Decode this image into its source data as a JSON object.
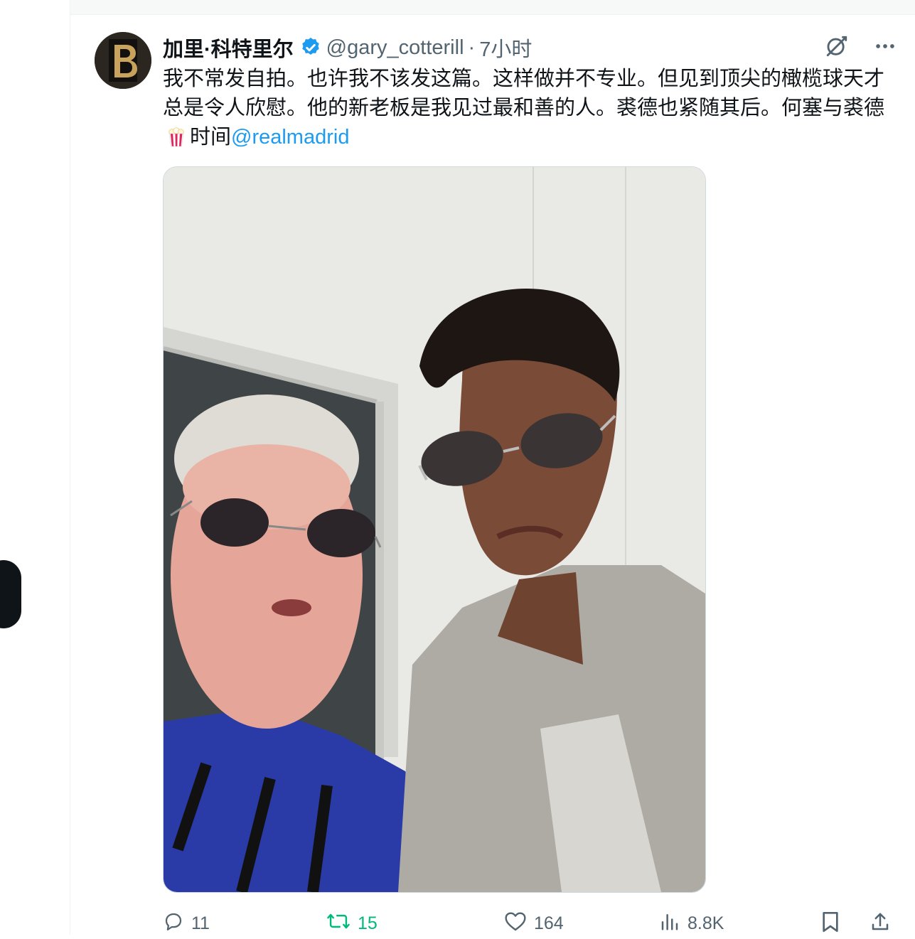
{
  "tweet": {
    "author": {
      "display_name": "加里·科特里尔",
      "handle": "@gary_cotterill",
      "avatar_letter": "B",
      "verified": true
    },
    "separator": "·",
    "timestamp": "7小时",
    "text": {
      "body": "我不常发自拍。也许我不该发这篇。这样做并不专业。但见到顶尖的橄榄球天才总是令人欣慰。他的新老板是我见过最和善的人。裘德也紧随其后。何塞与裘德",
      "after_emoji": "时间",
      "mention": "@realmadrid",
      "emoji": "popcorn"
    },
    "actions": {
      "replies": "11",
      "retweets": "15",
      "likes": "164",
      "views": "8.8K"
    }
  },
  "icons": {
    "grok": "grok-icon",
    "more": "more-icon",
    "reply": "reply-icon",
    "retweet": "retweet-icon",
    "like": "heart-icon",
    "views": "views-icon",
    "bookmark": "bookmark-icon",
    "share": "share-icon"
  },
  "colors": {
    "accent": "#1d9bf0",
    "retweet_active": "#00ba7c",
    "secondary_text": "#536471"
  }
}
